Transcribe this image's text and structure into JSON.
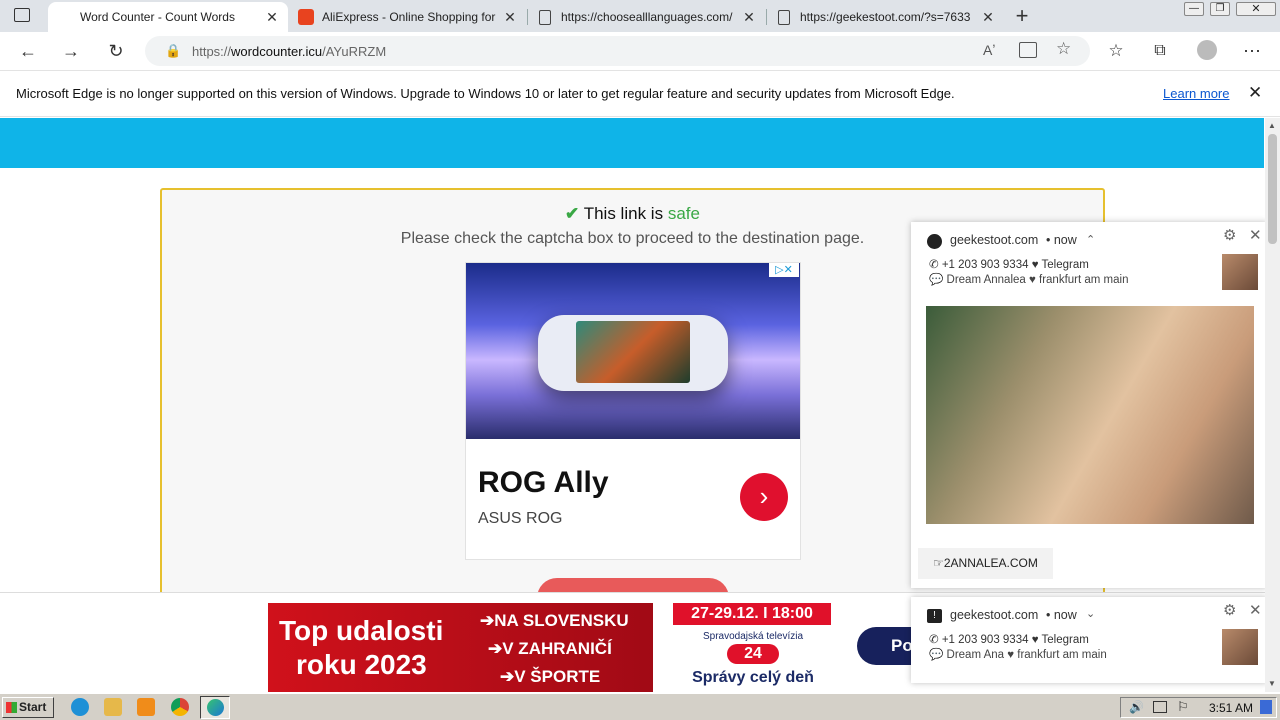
{
  "tabs": [
    {
      "title": "Word Counter - Count Words",
      "active": true
    },
    {
      "title": "AliExpress - Online Shopping for",
      "active": false
    },
    {
      "title": "https://choosealllanguages.com/",
      "active": false
    },
    {
      "title": "https://geekestoot.com/?s=7633",
      "active": false
    }
  ],
  "address": {
    "prefix": "https://",
    "domain": "wordcounter.icu",
    "path": "/AYuRRZM"
  },
  "infobar": {
    "message": "Microsoft Edge is no longer supported on this version of Windows. Upgrade to Windows 10 or later to get feature and security updates from Microsoft Edge.",
    "message_exact": "Microsoft Edge is no longer supported on this version of Windows. Upgrade to Windows 10 or later to get regular feature and security updates from Microsoft Edge.",
    "learn_more": "Learn more"
  },
  "page": {
    "safe_prefix": "This link is",
    "safe_word": "safe",
    "captcha_text": "Please check the captcha box to proceed to the destination page.",
    "ad": {
      "title": "ROG Ally",
      "subtitle": "ASUS ROG",
      "go": "›"
    }
  },
  "notifications": [
    {
      "site": "geekestoot.com",
      "time": "• now",
      "phone": "+1 203 903 9334 ♥ Telegram",
      "detail": "Dream Annalea ♥ frankfurt am main",
      "action": "☞2ANNALEA.COM"
    },
    {
      "site": "geekestoot.com",
      "time": "• now",
      "phone": "+1 203 903 9334 ♥ Telegram",
      "detail": "Dream Ana ♥ frankfurt am main"
    }
  ],
  "banner": {
    "headline1": "Top udalosti",
    "headline2": "roku 2023",
    "items": [
      "➔NA SLOVENSKU",
      "➔V ZAHRANIČÍ",
      "➔V ŠPORTE"
    ],
    "date": "27-29.12. I 18:00",
    "channel": "Spravodajská televízia",
    "logo": "24",
    "tagline": "Správy celý deň",
    "right": "Po"
  },
  "taskbar": {
    "start": "Start",
    "clock": "3:51 AM"
  }
}
